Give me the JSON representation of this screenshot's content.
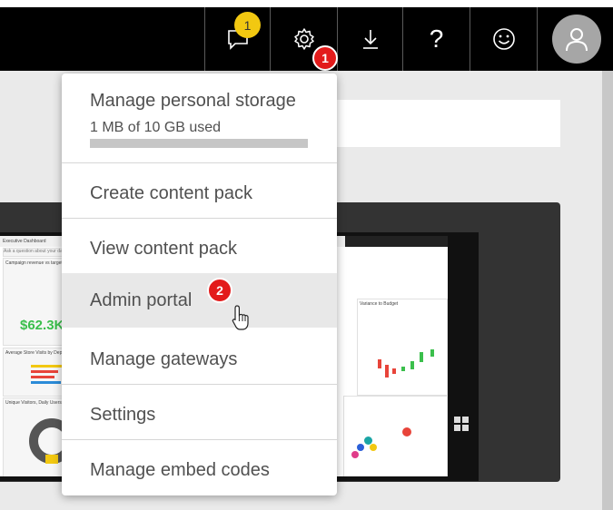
{
  "topbar": {
    "notification_count": "1",
    "icons": [
      "chat-icon",
      "gear-icon",
      "download-icon",
      "help-icon",
      "smiley-icon",
      "avatar-icon"
    ],
    "help_glyph": "?"
  },
  "callouts": {
    "first": "1",
    "second": "2"
  },
  "menu": {
    "storage": {
      "title": "Manage personal storage",
      "used": "1 MB of 10 GB used",
      "used_fraction": 0.0001
    },
    "items": [
      "Create content pack",
      "View content pack",
      "Admin portal",
      "Manage gateways",
      "Settings",
      "Manage embed codes"
    ]
  },
  "dashboard_preview": {
    "title": "Executive Dashboard",
    "qa_placeholder": "Ask a question about your data",
    "big_number": "$62.3K",
    "tile_titles": [
      "Campaign revenue vs target",
      "Average Store Visits by Dept",
      "Unique Visitors, Daily Users",
      "Variance to Budget"
    ]
  },
  "colors": {
    "accent_yellow": "#f2c811",
    "badge_red": "#e31b1b",
    "topbar": "#000000"
  }
}
